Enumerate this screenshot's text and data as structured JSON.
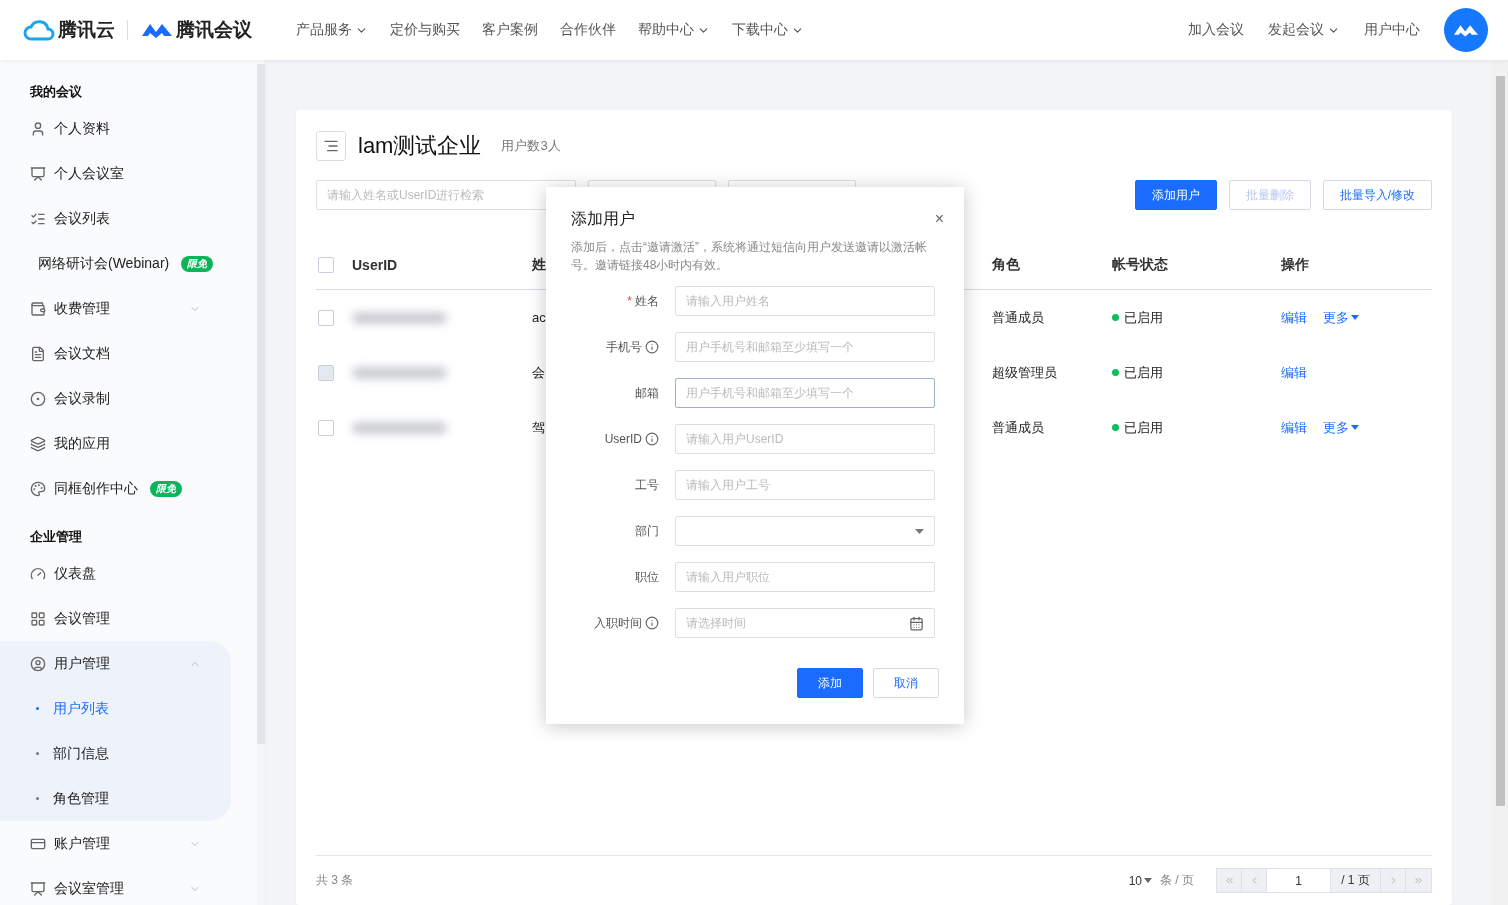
{
  "header": {
    "brand": "腾讯云",
    "product": "腾讯会议",
    "nav": [
      {
        "label": "产品服务",
        "dropdown": true
      },
      {
        "label": "定价与购买",
        "dropdown": false
      },
      {
        "label": "客户案例",
        "dropdown": false
      },
      {
        "label": "合作伙伴",
        "dropdown": false
      },
      {
        "label": "帮助中心",
        "dropdown": true
      },
      {
        "label": "下载中心",
        "dropdown": true
      }
    ],
    "actions": [
      {
        "label": "加入会议",
        "dropdown": false
      },
      {
        "label": "发起会议",
        "dropdown": true
      },
      {
        "label": "用户中心",
        "dropdown": false
      }
    ]
  },
  "sidebar": {
    "sections": [
      {
        "title": "我的会议",
        "items": [
          {
            "label": "个人资料"
          },
          {
            "label": "个人会议室"
          },
          {
            "label": "会议列表"
          },
          {
            "label": "网络研讨会(Webinar)",
            "badge": "限免"
          },
          {
            "label": "收费管理",
            "expanded": false
          },
          {
            "label": "会议文档"
          },
          {
            "label": "会议录制"
          },
          {
            "label": "我的应用"
          },
          {
            "label": "同框创作中心",
            "badge": "限免"
          }
        ]
      },
      {
        "title": "企业管理",
        "items": [
          {
            "label": "仪表盘"
          },
          {
            "label": "会议管理"
          },
          {
            "label": "用户管理",
            "expanded": true,
            "children": [
              {
                "label": "用户列表",
                "selected": true
              },
              {
                "label": "部门信息",
                "selected": false
              },
              {
                "label": "角色管理",
                "selected": false
              }
            ]
          },
          {
            "label": "账户管理",
            "expanded": false
          },
          {
            "label": "会议室管理",
            "expanded": false
          }
        ]
      }
    ]
  },
  "page": {
    "title": "lam测试企业",
    "count": "用户数3人",
    "search": {
      "placeholder": "请输入姓名或UserID进行检索"
    },
    "buttons": [
      {
        "label": "添加用户",
        "kind": "primary",
        "disabled": false
      },
      {
        "label": "批量删除",
        "kind": "outline",
        "disabled": true
      },
      {
        "label": "批量导入/修改",
        "kind": "outline",
        "disabled": false
      }
    ],
    "table": {
      "all_selected": false,
      "columns": {
        "userid": "UserID",
        "name": "姓",
        "role": "角色",
        "status": "帐号状态",
        "actions": "操作"
      },
      "rows": [
        {
          "name": "ac",
          "role": "普通成员",
          "status": "已启用",
          "enabled": true,
          "disabled": false,
          "edit": "编辑",
          "more": "更多"
        },
        {
          "name": "会",
          "role": "超级管理员",
          "status": "已启用",
          "enabled": true,
          "disabled": true,
          "edit": "编辑"
        },
        {
          "name": "驾",
          "role": "普通成员",
          "status": "已启用",
          "enabled": true,
          "disabled": false,
          "edit": "编辑",
          "more": "更多"
        }
      ]
    },
    "pagination": {
      "total": "共 3 条",
      "page_size": "10",
      "per_page": "条 / 页",
      "page": "1",
      "pages": "/ 1 页"
    }
  },
  "dialog": {
    "title": "添加用户",
    "close": "×",
    "required_mark": "*",
    "note": "添加后，点击“邀请激活”，系统将通过短信向用户发送邀请以激活帐号。邀请链接48小时内有效。",
    "fields": [
      {
        "label": "姓名",
        "required": true,
        "info": false,
        "kind": "input",
        "placeholder": "请输入用户姓名",
        "focused": false
      },
      {
        "label": "手机号",
        "required": false,
        "info": true,
        "kind": "input",
        "placeholder": "用户手机号和邮箱至少填写一个",
        "focused": false
      },
      {
        "label": "邮箱",
        "required": false,
        "info": false,
        "kind": "input",
        "placeholder": "用户手机号和邮箱至少填写一个",
        "focused": true
      },
      {
        "label": "UserID",
        "required": false,
        "info": true,
        "kind": "input",
        "placeholder": "请输入用户UserID",
        "focused": false
      },
      {
        "label": "工号",
        "required": false,
        "info": false,
        "kind": "input",
        "placeholder": "请输入用户工号",
        "focused": false
      },
      {
        "label": "部门",
        "required": false,
        "info": false,
        "kind": "select",
        "focused": false
      },
      {
        "label": "职位",
        "required": false,
        "info": false,
        "kind": "input",
        "placeholder": "请输入用户职位",
        "focused": false
      },
      {
        "label": "入职时间",
        "required": false,
        "info": true,
        "kind": "date",
        "placeholder": "请选择时间",
        "focused": false
      }
    ],
    "buttons": [
      {
        "label": "添加",
        "kind": "primary"
      },
      {
        "label": "取消",
        "kind": "outline"
      }
    ]
  }
}
